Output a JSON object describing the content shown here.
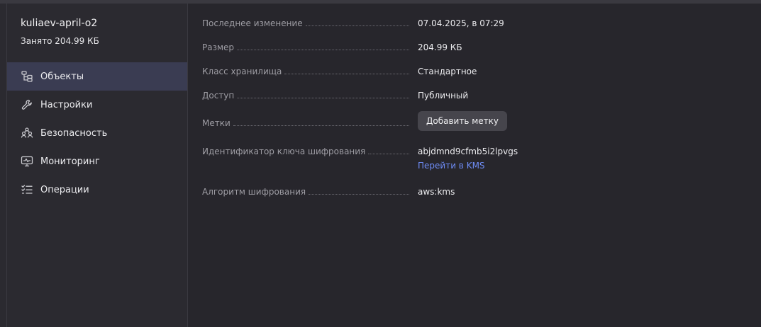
{
  "sidebar": {
    "bucket_name": "kuliaev-april-o2",
    "used": "Занято 204.99 КБ",
    "items": [
      {
        "label": "Объекты",
        "icon": "objects-icon",
        "active": true
      },
      {
        "label": "Настройки",
        "icon": "wrench-icon",
        "active": false
      },
      {
        "label": "Безопасность",
        "icon": "users-icon",
        "active": false
      },
      {
        "label": "Мониторинг",
        "icon": "monitor-icon",
        "active": false
      },
      {
        "label": "Операции",
        "icon": "checklist-icon",
        "active": false
      }
    ]
  },
  "details": {
    "last_modified": {
      "label": "Последнее изменение",
      "value": "07.04.2025, в 07:29"
    },
    "size": {
      "label": "Размер",
      "value": "204.99 КБ"
    },
    "storage_class": {
      "label": "Класс хранилища",
      "value": "Стандартное"
    },
    "access": {
      "label": "Доступ",
      "value": "Публичный"
    },
    "tags": {
      "label": "Метки",
      "button": "Добавить метку"
    },
    "encryption_key": {
      "label": "Идентификатор ключа шифрования",
      "value": "abjdmnd9cfmb5i2lpvgs",
      "link": "Перейти в KMS"
    },
    "encryption_algorithm": {
      "label": "Алгоритм шифрования",
      "value": "aws:kms"
    }
  },
  "colors": {
    "background": "#27262c",
    "sidebar_bg": "#2b2a30",
    "active_item_bg": "#3a3c52",
    "link": "#6e8cf5",
    "button_bg": "#46454c"
  }
}
